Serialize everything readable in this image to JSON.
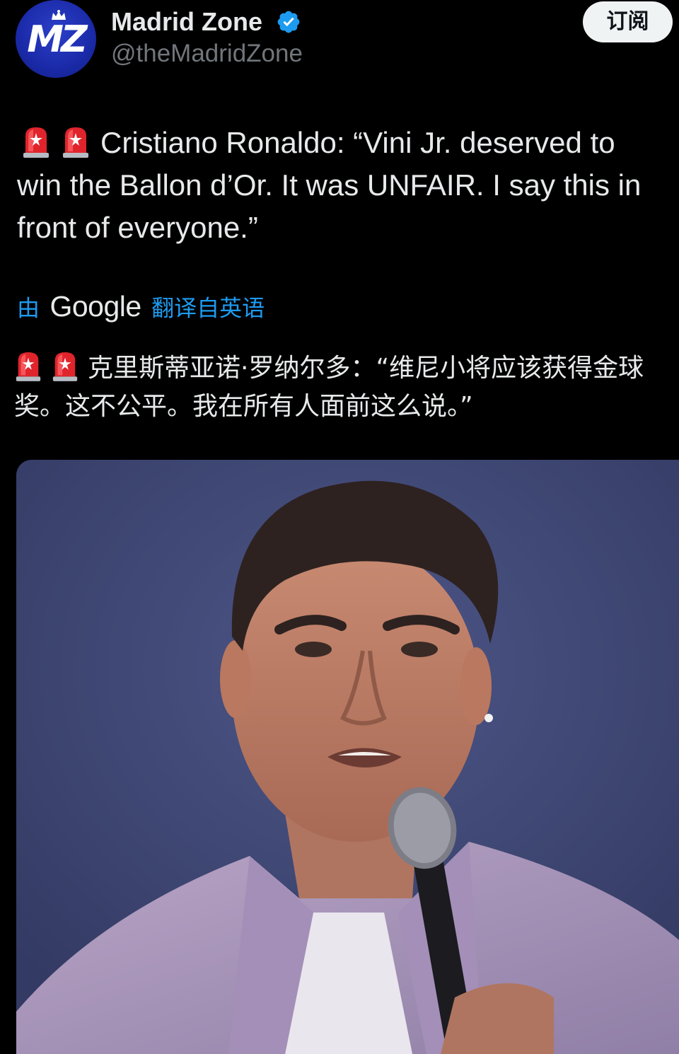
{
  "account": {
    "display_name": "Madrid Zone",
    "handle": "@theMadridZone",
    "avatar_text": "MZ",
    "verified": true
  },
  "subscribe_label": "订阅",
  "tweet": {
    "emoji": [
      "rotating-light",
      "rotating-light"
    ],
    "text": "Cristiano Ronaldo: “Vini Jr. deserved to win the Ballon d’Or. It was UNFAIR. I say this in front of everyone.”"
  },
  "translation": {
    "by": "由",
    "provider": "Google",
    "label": "翻译自英语",
    "text": "克里斯蒂亚诺·罗纳尔多：“维尼小将应该获得金球奖。这不公平。我在所有人面前这么说。”"
  },
  "media": {
    "alt": "photo"
  },
  "colors": {
    "background": "#000000",
    "text": "#e7e9ea",
    "secondary_text": "#71767b",
    "link_blue": "#1d9bf0",
    "verified_blue": "#1d9bf0",
    "avatar_blue": "#1a2aa8",
    "button_bg": "#eff3f4"
  }
}
